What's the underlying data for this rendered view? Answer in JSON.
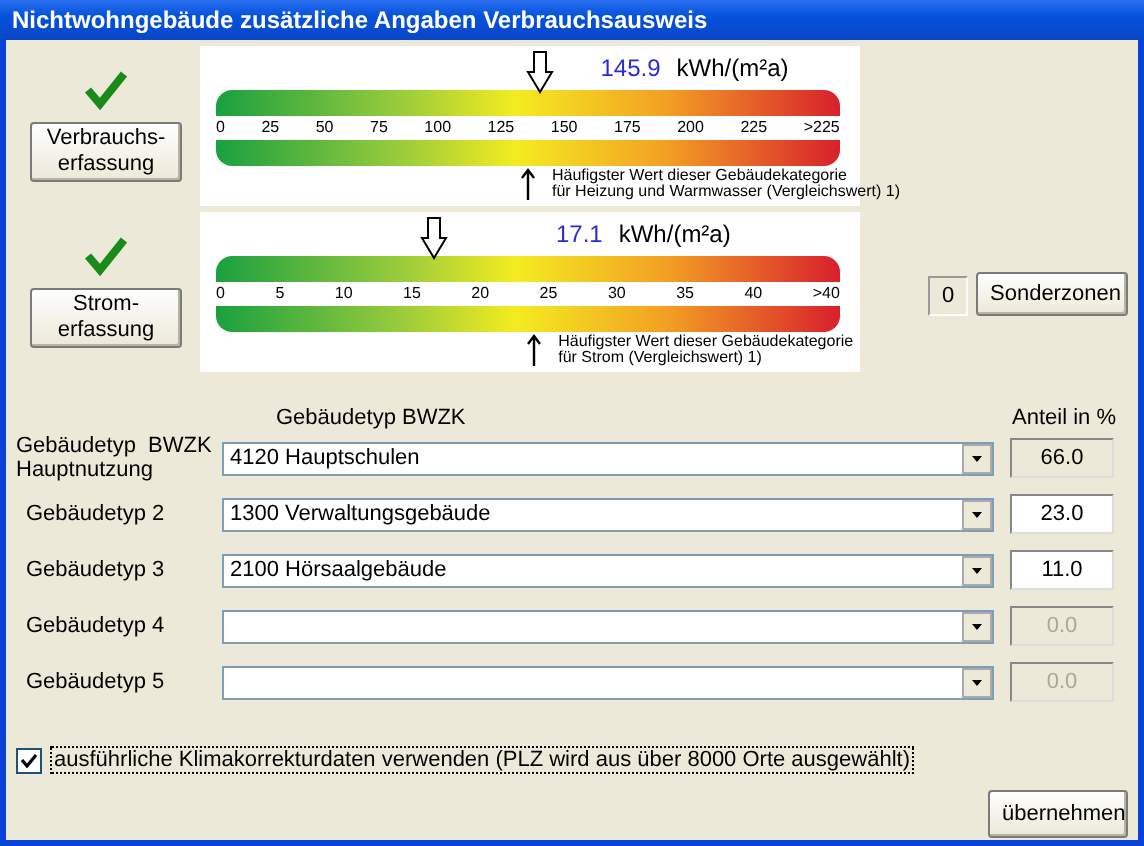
{
  "window": {
    "title": "Nichtwohngebäude zusätzliche Angaben Verbrauchsausweis"
  },
  "meters": [
    {
      "done": true,
      "button": "Verbrauchs-\nerfassung",
      "value": "145.9",
      "unit": "kWh/(m²a)",
      "level": 0.52,
      "reference": {
        "level": 0.5
      },
      "ticks": [
        "0",
        "25",
        "50",
        "75",
        "100",
        "125",
        "150",
        "175",
        "200",
        "225",
        ">225"
      ],
      "note": "Häufigster Wert dieser Gebäudekategorie\nfür Heizung und Warmwasser (Vergleichswert) 1)"
    },
    {
      "done": true,
      "button": "Strom-\nerfassung",
      "value": "17.1",
      "unit": "kWh/(m²a)",
      "level": 0.35,
      "reference": {
        "level": 0.51
      },
      "ticks": [
        "0",
        "5",
        "10",
        "15",
        "20",
        "25",
        "30",
        "35",
        "40",
        ">40"
      ],
      "note": "Häufigster Wert dieser Gebäudekategorie\nfür Strom (Vergleichswert) 1)"
    }
  ],
  "special_zones": {
    "count": "0",
    "button": "Sonderzonen"
  },
  "table": {
    "type_header": "Gebäudetyp BWZK",
    "share_header": "Anteil in %",
    "rows": [
      {
        "label": "Gebäudetyp  BWZK\nHauptnutzung",
        "value": "4120 Hauptschulen",
        "share": "66.0",
        "share_readonly": true,
        "share_disabled": false
      },
      {
        "label": "Gebäudetyp 2",
        "value": "1300 Verwaltungsgebäude",
        "share": "23.0",
        "share_readonly": false,
        "share_disabled": false
      },
      {
        "label": "Gebäudetyp 3",
        "value": "2100 Hörsaalgebäude",
        "share": "11.0",
        "share_readonly": false,
        "share_disabled": false
      },
      {
        "label": "Gebäudetyp 4",
        "share": "0.0",
        "share_readonly": false,
        "share_disabled": true
      },
      {
        "label": "Gebäudetyp 5",
        "share": "0.0",
        "share_readonly": false,
        "share_disabled": true
      }
    ]
  },
  "climate_option": {
    "label": "ausführliche Klimakorrekturdaten verwenden (PLZ  wird aus über 8000 Orte ausgewählt)",
    "checked": true
  },
  "apply_button": "übernehmen"
}
